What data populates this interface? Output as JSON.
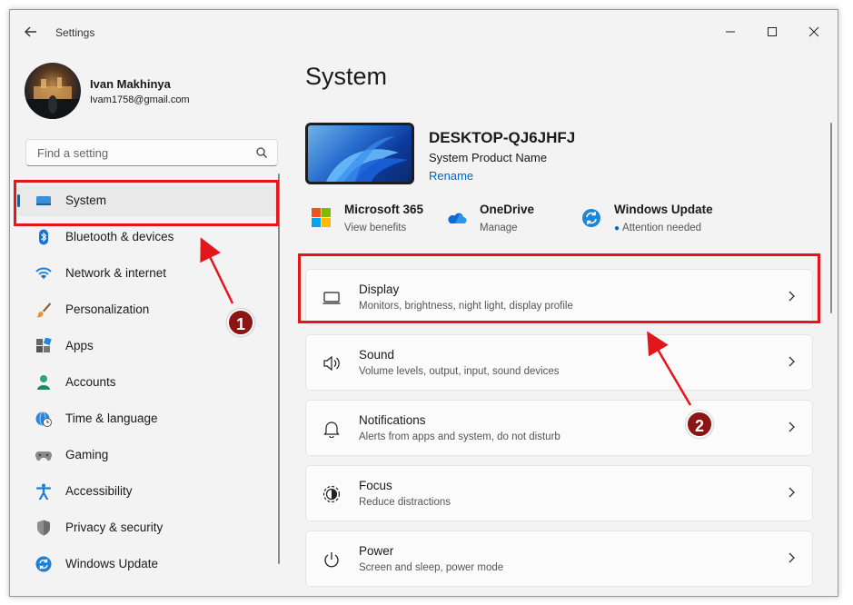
{
  "window": {
    "title": "Settings"
  },
  "user": {
    "name": "Ivan Makhinya",
    "email": "Ivam1758@gmail.com"
  },
  "search": {
    "placeholder": "Find a setting"
  },
  "sidebar": {
    "items": [
      {
        "label": "System",
        "icon": "system-display-icon",
        "active": true
      },
      {
        "label": "Bluetooth & devices",
        "icon": "bluetooth-icon"
      },
      {
        "label": "Network & internet",
        "icon": "wifi-icon"
      },
      {
        "label": "Personalization",
        "icon": "brush-icon"
      },
      {
        "label": "Apps",
        "icon": "apps-icon"
      },
      {
        "label": "Accounts",
        "icon": "person-icon"
      },
      {
        "label": "Time & language",
        "icon": "globe-clock-icon"
      },
      {
        "label": "Gaming",
        "icon": "gamepad-icon"
      },
      {
        "label": "Accessibility",
        "icon": "accessibility-icon"
      },
      {
        "label": "Privacy & security",
        "icon": "shield-icon"
      },
      {
        "label": "Windows Update",
        "icon": "update-icon"
      }
    ]
  },
  "main": {
    "title": "System",
    "device": {
      "name": "DESKTOP-QJ6JHFJ",
      "product": "System Product Name",
      "rename": "Rename"
    },
    "quick_links": [
      {
        "title": "Microsoft 365",
        "subtitle": "View benefits",
        "icon": "microsoft-logo-icon"
      },
      {
        "title": "OneDrive",
        "subtitle": "Manage",
        "icon": "onedrive-cloud-icon"
      },
      {
        "title": "Windows Update",
        "subtitle": "Attention needed",
        "icon": "windows-update-icon"
      }
    ],
    "cards": [
      {
        "title": "Display",
        "subtitle": "Monitors, brightness, night light, display profile",
        "icon": "monitor-icon"
      },
      {
        "title": "Sound",
        "subtitle": "Volume levels, output, input, sound devices",
        "icon": "speaker-icon"
      },
      {
        "title": "Notifications",
        "subtitle": "Alerts from apps and system, do not disturb",
        "icon": "bell-icon"
      },
      {
        "title": "Focus",
        "subtitle": "Reduce distractions",
        "icon": "focus-icon"
      },
      {
        "title": "Power",
        "subtitle": "Screen and sleep, power mode",
        "icon": "power-icon"
      }
    ]
  },
  "annotations": {
    "badge1": "1",
    "badge2": "2"
  },
  "colors": {
    "accent": "#0067c0",
    "highlight": "#e3161c",
    "badge": "#8b1414"
  }
}
